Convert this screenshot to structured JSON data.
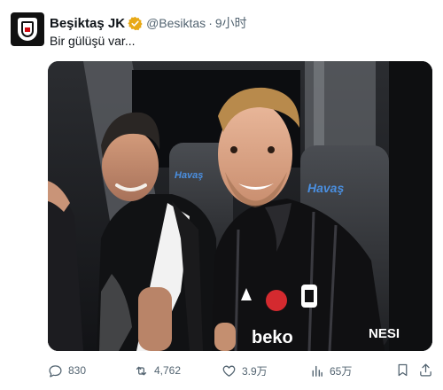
{
  "account": {
    "name": "Beşiktaş JK",
    "handle": "@Besiktas",
    "separator": "·",
    "time": "9小时"
  },
  "tweet": {
    "text": "Bir gülüşü var..."
  },
  "photo": {
    "seat_logo_left": "Havaş",
    "seat_logo_right": "Havaş",
    "jersey_sponsor": "beko",
    "sleeve_sponsor": "NESI"
  },
  "metrics": {
    "replies": "830",
    "retweets": "4,762",
    "likes": "3.9万",
    "views": "65万"
  },
  "colors": {
    "verified": "#e8a916",
    "icon": "#536471"
  }
}
